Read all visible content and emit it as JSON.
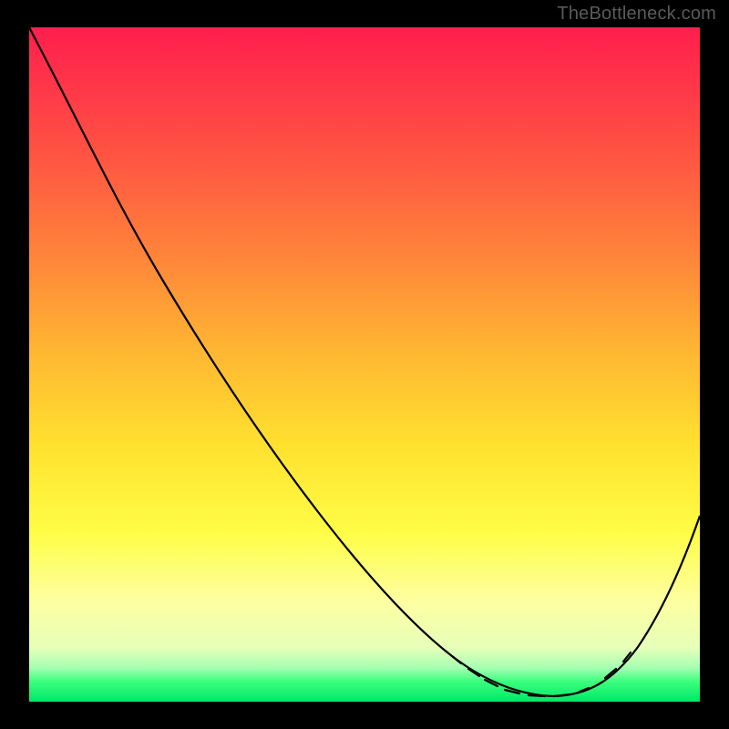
{
  "watermark": "TheBottleneck.com",
  "chart_data": {
    "type": "line",
    "title": "",
    "xlabel": "",
    "ylabel": "",
    "x": [
      0.0,
      0.05,
      0.1,
      0.15,
      0.2,
      0.25,
      0.3,
      0.35,
      0.4,
      0.45,
      0.5,
      0.55,
      0.6,
      0.63,
      0.66,
      0.69,
      0.72,
      0.75,
      0.78,
      0.81,
      0.84,
      0.87,
      0.9,
      0.93,
      0.96,
      1.0
    ],
    "values": [
      1.0,
      0.91,
      0.82,
      0.73,
      0.64,
      0.56,
      0.48,
      0.41,
      0.34,
      0.28,
      0.22,
      0.17,
      0.12,
      0.095,
      0.072,
      0.052,
      0.035,
      0.018,
      0.007,
      0.002,
      0.006,
      0.023,
      0.055,
      0.105,
      0.17,
      0.27
    ],
    "xlim": [
      0,
      1
    ],
    "ylim": [
      0,
      1
    ],
    "minimum_x": 0.78,
    "highlight_band_y": [
      0.0,
      0.07
    ],
    "background_gradient": [
      "#ff1e4e",
      "#ffe12f",
      "#00e768"
    ],
    "highlighted_segments_x": [
      [
        0.63,
        0.645
      ],
      [
        0.655,
        0.67
      ],
      [
        0.68,
        0.7
      ],
      [
        0.71,
        0.73
      ],
      [
        0.745,
        0.77
      ],
      [
        0.782,
        0.805
      ],
      [
        0.82,
        0.835
      ],
      [
        0.858,
        0.875
      ],
      [
        0.886,
        0.897
      ]
    ]
  }
}
